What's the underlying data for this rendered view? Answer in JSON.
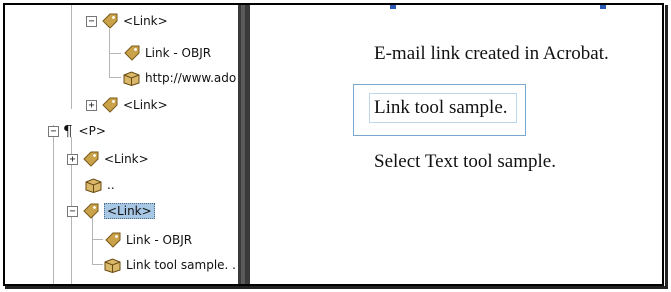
{
  "tags_tree": {
    "nodes": [
      {
        "label": "<Link>",
        "expander": "−",
        "icon": "tag-icon"
      },
      {
        "label": "Link - OBJR",
        "icon": "tag-icon"
      },
      {
        "label": "http://www.ado",
        "icon": "content-box-icon"
      },
      {
        "label": "<Link>",
        "expander": "+",
        "icon": "tag-icon"
      },
      {
        "label": "<P>",
        "expander": "−",
        "icon": "pilcrow-icon",
        "glyph": "¶"
      },
      {
        "label": "<Link>",
        "expander": "+",
        "icon": "tag-icon"
      },
      {
        "label": "..",
        "icon": "content-box-icon"
      },
      {
        "label": "<Link>",
        "expander": "−",
        "icon": "tag-icon",
        "selected": true
      },
      {
        "label": "Link - OBJR",
        "icon": "tag-icon"
      },
      {
        "label": "Link tool sample. .",
        "icon": "content-box-icon"
      }
    ]
  },
  "document": {
    "lines": [
      "E-mail link created in Acrobat.",
      "Link tool sample.",
      "Select Text tool sample."
    ]
  },
  "colors": {
    "selection": "#a7c7e4",
    "link_box": "#7aa8d0",
    "divider": "#3a3a3a",
    "tag_icon": "#c9a24a"
  }
}
